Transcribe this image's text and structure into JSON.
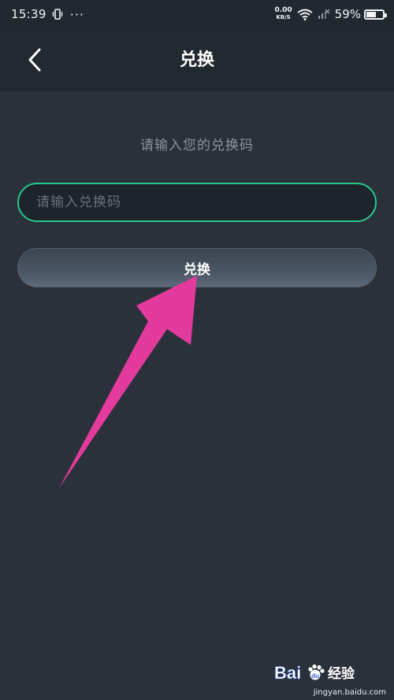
{
  "status_bar": {
    "time": "15:39",
    "more": "···",
    "net_speed_value": "0.00",
    "net_speed_unit": "KB/S",
    "battery_percent": "59%",
    "battery_level": 0.59
  },
  "nav": {
    "title": "兑换",
    "back_icon": "chevron-left-icon"
  },
  "main": {
    "prompt": "请输入您的兑换码",
    "code_input": {
      "value": "",
      "placeholder": "请输入兑换码"
    },
    "redeem_button_label": "兑换"
  },
  "colors": {
    "background": "#2b313b",
    "nav_background": "#222930",
    "input_border_accent": "#27c88c",
    "annotation_arrow": "#e23a9d"
  },
  "watermark": {
    "logo_text": "Bai 经验",
    "url": "jingyan.baidu.com"
  }
}
